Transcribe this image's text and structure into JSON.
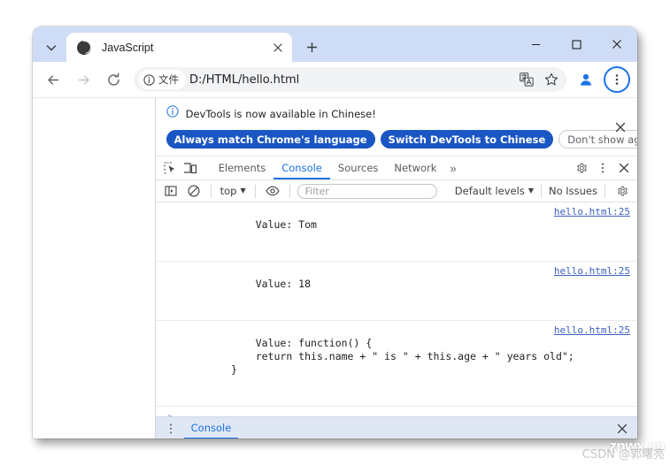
{
  "window": {
    "minimize_label": "Minimize",
    "maximize_label": "Maximize",
    "close_label": "Close"
  },
  "tabstrip": {
    "search_tabs_label": "Search tabs",
    "new_tab_label": "New tab",
    "tabs": [
      {
        "title": "JavaScript",
        "favicon": "globe-icon",
        "close_label": "Close tab"
      }
    ]
  },
  "toolbar": {
    "back_label": "Back",
    "forward_label": "Forward",
    "reload_label": "Reload",
    "security_chip": "文件",
    "url": "D:/HTML/hello.html",
    "translate_label": "Translate this page",
    "bookmark_label": "Bookmark this tab",
    "profile_label": "Profile",
    "menu_label": "Customize and control Google Chrome"
  },
  "devtools": {
    "notification": {
      "icon": "info-icon",
      "message": "DevTools is now available in Chinese!",
      "buttons": [
        {
          "label": "Always match Chrome's language",
          "style": "primary"
        },
        {
          "label": "Switch DevTools to Chinese",
          "style": "primary"
        },
        {
          "label": "Don't show again",
          "style": "ghost"
        }
      ],
      "close_label": "Close"
    },
    "tabbar": {
      "inspect_label": "Inspect element",
      "device_toolbar_label": "Toggle device toolbar",
      "tabs": [
        {
          "label": "Elements",
          "active": false
        },
        {
          "label": "Console",
          "active": true
        },
        {
          "label": "Sources",
          "active": false
        },
        {
          "label": "Network",
          "active": false
        }
      ],
      "more_tabs": "»",
      "settings_label": "Settings",
      "more_options_label": "More options",
      "close_label": "Close DevTools"
    },
    "console_toolbar": {
      "sidebar_label": "Show console sidebar",
      "clear_label": "Clear console",
      "context": "top",
      "eye_label": "Create live expression",
      "filter_placeholder": "Filter",
      "filter_value": "",
      "levels": "Default levels",
      "issues": "No Issues",
      "settings_label": "Console settings"
    },
    "messages": [
      {
        "text": "Value: Tom",
        "source": "hello.html:25"
      },
      {
        "text": "Value: 18",
        "source": "hello.html:25"
      },
      {
        "text": "Value: function() {\n            return this.name + \" is \" + this.age + \" years old\";\n        }",
        "source": "hello.html:25"
      }
    ],
    "prompt_symbol": ">",
    "drawer": {
      "more_label": "More tools",
      "tab": "Console",
      "close_label": "Close drawer"
    }
  },
  "watermark": {
    "primary": "znwx.cn",
    "secondary": "CSDN @郭曙亮"
  },
  "colors": {
    "accent": "#1a73e8",
    "tabstrip_bg": "#cfdcf5",
    "button_primary": "#1a56c4",
    "link": "#3b5fc0",
    "drawer_bg": "#dfe7f5"
  }
}
